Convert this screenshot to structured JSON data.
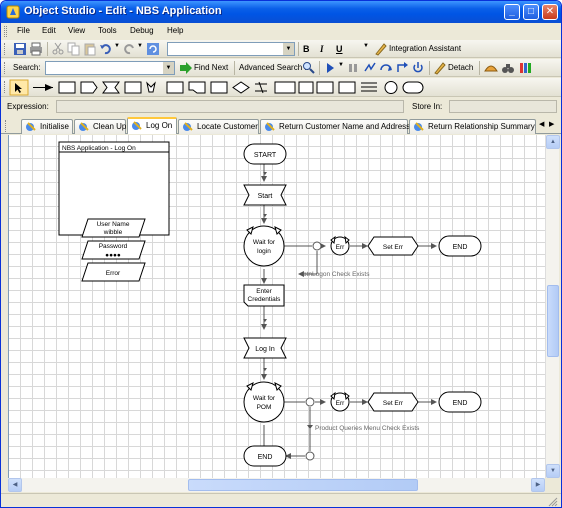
{
  "window": {
    "title": "Object Studio - Edit - NBS Application"
  },
  "titlebar_buttons": {
    "minimize": "_",
    "maximize": "□",
    "close": "✕"
  },
  "menu": [
    "File",
    "Edit",
    "View",
    "Tools",
    "Debug",
    "Help"
  ],
  "toolbar1": {
    "bold": "B",
    "italic": "I",
    "underline": "U",
    "integration_assistant": "Integration Assistant"
  },
  "toolbar2": {
    "search_label": "Search:",
    "find_next": "Find Next",
    "advanced_search": "Advanced Search ...",
    "detach": "Detach"
  },
  "expression": {
    "label": "Expression:",
    "store_in_label": "Store In:"
  },
  "tabs": [
    "Initialise",
    "Clean Up",
    "Log On",
    "Locate Customer",
    "Return Customer Name and Address",
    "Return Relationship Summary"
  ],
  "active_tab_index": 2,
  "colors": {
    "accent": "#0a5fe8",
    "tab_highlight": "#ffc83c",
    "grid": "#d8d8d8",
    "connector": "#555555"
  },
  "diagram": {
    "region_title": "NBS Application - Log On",
    "left_elements": [
      {
        "label": "User Name",
        "value": "wibble"
      },
      {
        "label": "Password",
        "value": "●●●●"
      },
      {
        "label": "Error",
        "value": ""
      }
    ],
    "start": "START",
    "start_page": "Start",
    "wait1": [
      "Wait for",
      "login"
    ],
    "err1": "Err",
    "set_err1": "Set Err",
    "end1": "END",
    "check1": "btnLogon Check Exists",
    "enter_credentials": [
      "Enter",
      "Credentials"
    ],
    "log_in": "Log In",
    "wait2": [
      "Wait for",
      "POM"
    ],
    "err2": "Err",
    "set_err2": "Set Err",
    "end2": "END",
    "check2": "Product Queries Menu Check Exists",
    "end3": "END"
  }
}
